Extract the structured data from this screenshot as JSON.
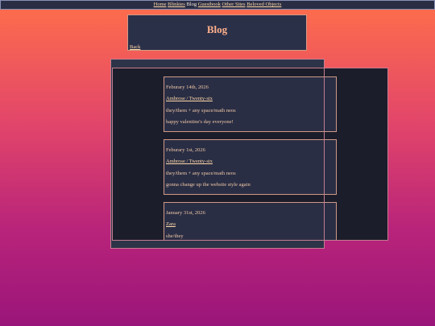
{
  "nav": {
    "items": [
      {
        "label": "Home",
        "link": true
      },
      {
        "label": "Blinkies",
        "link": true
      },
      {
        "label": "Blog",
        "link": false
      },
      {
        "label": "Guestbook",
        "link": true
      },
      {
        "label": "Other Sites",
        "link": true
      },
      {
        "label": "Beloved Objects",
        "link": true
      }
    ]
  },
  "header": {
    "title": "Blog",
    "back_label": "Back"
  },
  "posts": [
    {
      "date": "Feburary 14th, 2026",
      "author": "Ambrose / Twenty-six",
      "pronouns": "they/them + any space/math neos",
      "body": "happy valentine's day everyone!"
    },
    {
      "date": "Feburary 1st, 2026",
      "author": "Ambrose / Twenty-six",
      "pronouns": "they/them + any space/math neos",
      "body": "gonna change up the website style again"
    },
    {
      "date": "January 31st, 2026",
      "author": "Zara",
      "pronouns": "she/they"
    }
  ],
  "colors": {
    "background_top": "#ff6f4a",
    "background_bottom": "#9a157a",
    "panel": "#2a2e45",
    "border": "#d09a86",
    "link": "#ffd9a8",
    "title": "#ffb08a"
  }
}
